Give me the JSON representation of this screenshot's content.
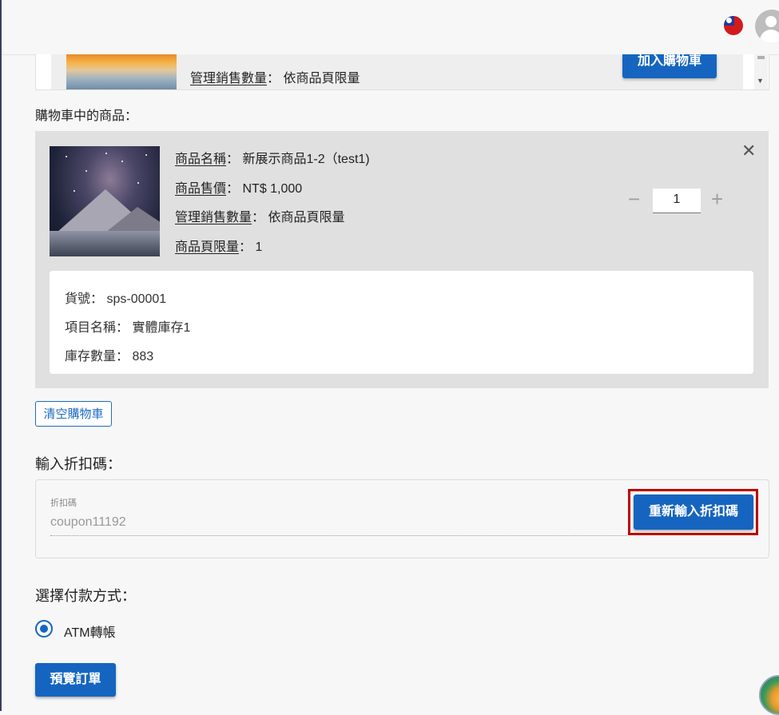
{
  "header": {
    "language_flag": "taiwan-flag-icon",
    "avatar_icon": "user-avatar-icon"
  },
  "product_strip": {
    "label_key": "管理銷售數量",
    "label_sep": "：",
    "label_value": "依商品頁限量",
    "add_to_cart_label": "加入購物車"
  },
  "cart": {
    "section_title": "購物車中的商品：",
    "item": {
      "name_key": "商品名稱",
      "name_value": "新展示商品1-2（test1)",
      "price_key": "商品售價",
      "price_value": "NT$ 1,000",
      "sales_key": "管理銷售數量",
      "sales_value": "依商品頁限量",
      "limit_key": "商品頁限量",
      "limit_value": "1",
      "sep": "：",
      "quantity": "1",
      "minus_symbol": "−",
      "plus_symbol": "+",
      "close_symbol": "✕"
    },
    "sku": {
      "sku_key": "貨號",
      "sku_value": "sps-00001",
      "item_name_key": "項目名稱",
      "item_name_value": "實體庫存1",
      "stock_key": "庫存數量",
      "stock_value": "883",
      "sep": "： "
    },
    "clear_cart_label": "清空購物車"
  },
  "coupon": {
    "title": "輸入折扣碼：",
    "field_label": "折扣碼",
    "field_value": "coupon11192",
    "reenter_label": "重新輸入折扣碼"
  },
  "payment": {
    "title": "選擇付款方式：",
    "option_label": "ATM轉帳",
    "selected": true
  },
  "preview_order_label": "預覽訂單",
  "colors": {
    "primary": "#1565c0",
    "highlight": "#c00000"
  }
}
